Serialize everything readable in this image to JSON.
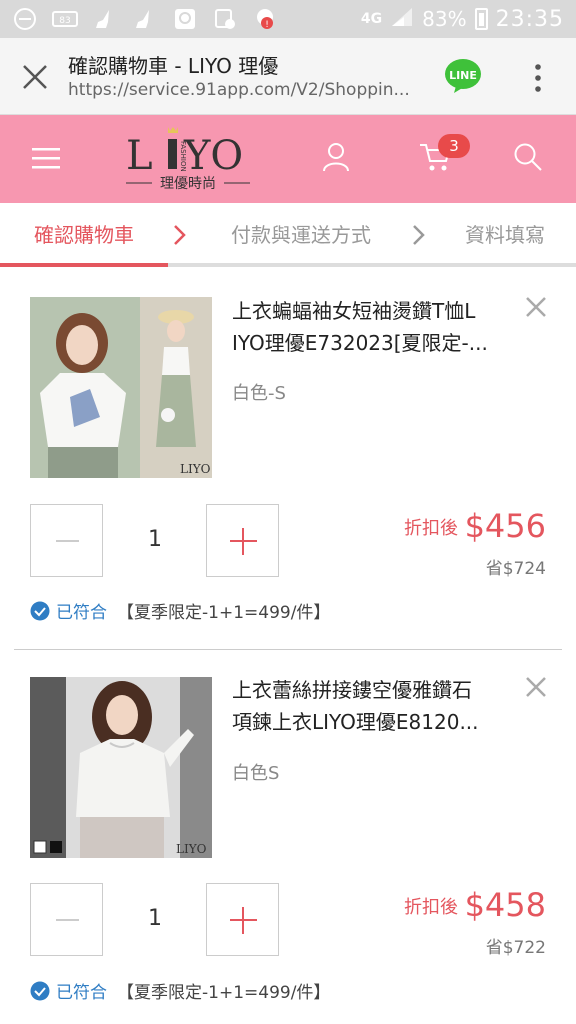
{
  "status_bar": {
    "network": "4G",
    "battery": "83%",
    "time": "23:35",
    "icons": [
      "minus-circle-icon",
      "data-icon",
      "broom-icon",
      "broom-icon",
      "chat-icon",
      "calendar-icon",
      "alert-icon"
    ]
  },
  "browser": {
    "title": "確認購物車 - LIYO 理優",
    "url": "https://service.91app.com/V2/Shoppin...",
    "line_label": "LINE"
  },
  "header": {
    "logo_text": "LIYO",
    "logo_sub": "理優時尚",
    "logo_side": "FASHION",
    "cart_count": "3",
    "accent": "#f797b0"
  },
  "steps": [
    {
      "label": "確認購物車"
    },
    {
      "label": "付款與運送方式"
    },
    {
      "label": "資料填寫"
    }
  ],
  "items": [
    {
      "title": "上衣蝙蝠袖女短袖燙鑽T恤LIYO理優E732023[夏限定-...",
      "title_line1": "上衣蝙蝠袖女短袖燙鑽T恤L",
      "title_line2": "IYO理優E732023[夏限定-...",
      "spec": "白色-S",
      "qty": "1",
      "price_label": "折扣後",
      "price": "$456",
      "saving": "省$724",
      "promo_status": "已符合",
      "promo_desc": "【夏季限定-1+1=499/件】",
      "img_brand": "LIYO"
    },
    {
      "title": "上衣蕾絲拼接鏤空優雅鑽石項鍊上衣LIYO理優E8120...",
      "title_line1": "上衣蕾絲拼接鏤空優雅鑽石",
      "title_line2": "項鍊上衣LIYO理優E8120...",
      "spec": "白色S",
      "qty": "1",
      "price_label": "折扣後",
      "price": "$458",
      "saving": "省$722",
      "promo_status": "已符合",
      "promo_desc": "【夏季限定-1+1=499/件】",
      "img_brand": "LIYO"
    }
  ],
  "colors": {
    "accent_red": "#e4565e",
    "check_blue": "#2f7dc4"
  }
}
